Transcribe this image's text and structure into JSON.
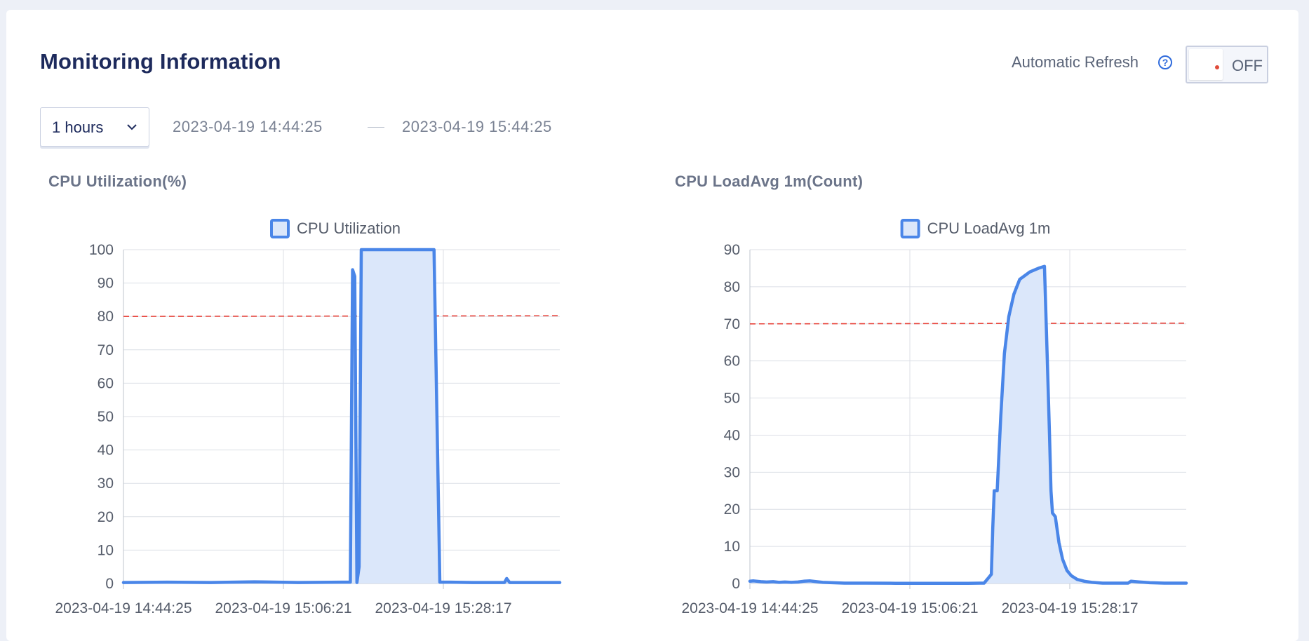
{
  "header": {
    "title": "Monitoring Information",
    "auto_refresh_label": "Automatic Refresh",
    "auto_refresh_help": "?",
    "auto_refresh_state": "OFF"
  },
  "time_range": {
    "selected": "1 hours",
    "start": "2023-04-19 14:44:25",
    "end": "2023-04-19 15:44:25"
  },
  "colors": {
    "accent": "#4a86e8",
    "threshold": "#e8453c",
    "fill": "#dbe7fa"
  },
  "chart_data": [
    {
      "type": "area",
      "title": "CPU Utilization(%)",
      "legend": "CPU Utilization",
      "x_labels": [
        "2023-04-19 14:44:25",
        "2023-04-19 15:06:21",
        "2023-04-19 15:28:17"
      ],
      "x_range_minutes": [
        0,
        60
      ],
      "ylim": [
        0,
        100
      ],
      "yticks": [
        0,
        10,
        20,
        30,
        40,
        50,
        60,
        70,
        80,
        90,
        100
      ],
      "threshold": 80,
      "grid": true,
      "legend_placement": "top-center",
      "series": [
        {
          "name": "CPU Utilization",
          "x": [
            0,
            6,
            12,
            18,
            24,
            30,
            31.2,
            31.5,
            31.8,
            32.1,
            32.4,
            32.7,
            33.6,
            38,
            42,
            42.7,
            43.5,
            45,
            48,
            52.4,
            52.7,
            53.1,
            56,
            60
          ],
          "y": [
            0.3,
            0.4,
            0.3,
            0.5,
            0.3,
            0.4,
            0.4,
            94,
            92,
            0.3,
            5,
            100,
            100,
            100,
            100,
            100,
            0.4,
            0.4,
            0.3,
            0.3,
            1.5,
            0.3,
            0.3,
            0.3
          ]
        }
      ]
    },
    {
      "type": "area",
      "title": "CPU LoadAvg 1m(Count)",
      "legend": "CPU LoadAvg 1m",
      "x_labels": [
        "2023-04-19 14:44:25",
        "2023-04-19 15:06:21",
        "2023-04-19 15:28:17"
      ],
      "x_range_minutes": [
        0,
        60
      ],
      "ylim": [
        0,
        90
      ],
      "yticks": [
        0,
        10,
        20,
        30,
        40,
        50,
        60,
        70,
        80,
        90
      ],
      "threshold": 70,
      "grid": true,
      "legend_placement": "top-center",
      "series": [
        {
          "name": "CPU LoadAvg 1m",
          "x": [
            0,
            0.5,
            1.5,
            2.3,
            3.2,
            4,
            4.8,
            5.7,
            6.6,
            7.4,
            8.3,
            10,
            13,
            16,
            20,
            25,
            30,
            32.2,
            32.8,
            33.2,
            33.4,
            33.6,
            34,
            34.5,
            35,
            35.6,
            36.3,
            37.1,
            38.5,
            39.7,
            40.5,
            40.9,
            41.2,
            41.4,
            41.6,
            42,
            42.5,
            43,
            43.6,
            44.2,
            45,
            46,
            47,
            48.5,
            51,
            52,
            52.4,
            53.6,
            55,
            57,
            60
          ],
          "y": [
            0.6,
            0.7,
            0.5,
            0.4,
            0.5,
            0.3,
            0.4,
            0.3,
            0.4,
            0.6,
            0.7,
            0.3,
            0.1,
            0.1,
            0.05,
            0.05,
            0.05,
            0.1,
            1.5,
            2.5,
            15,
            25,
            25,
            45,
            62,
            72,
            78,
            82,
            84,
            85,
            85.5,
            60,
            40,
            25,
            19,
            18,
            11,
            6.5,
            3.5,
            2.1,
            1.1,
            0.6,
            0.3,
            0.1,
            0.1,
            0.1,
            0.6,
            0.4,
            0.2,
            0.1,
            0.1
          ]
        }
      ]
    }
  ]
}
